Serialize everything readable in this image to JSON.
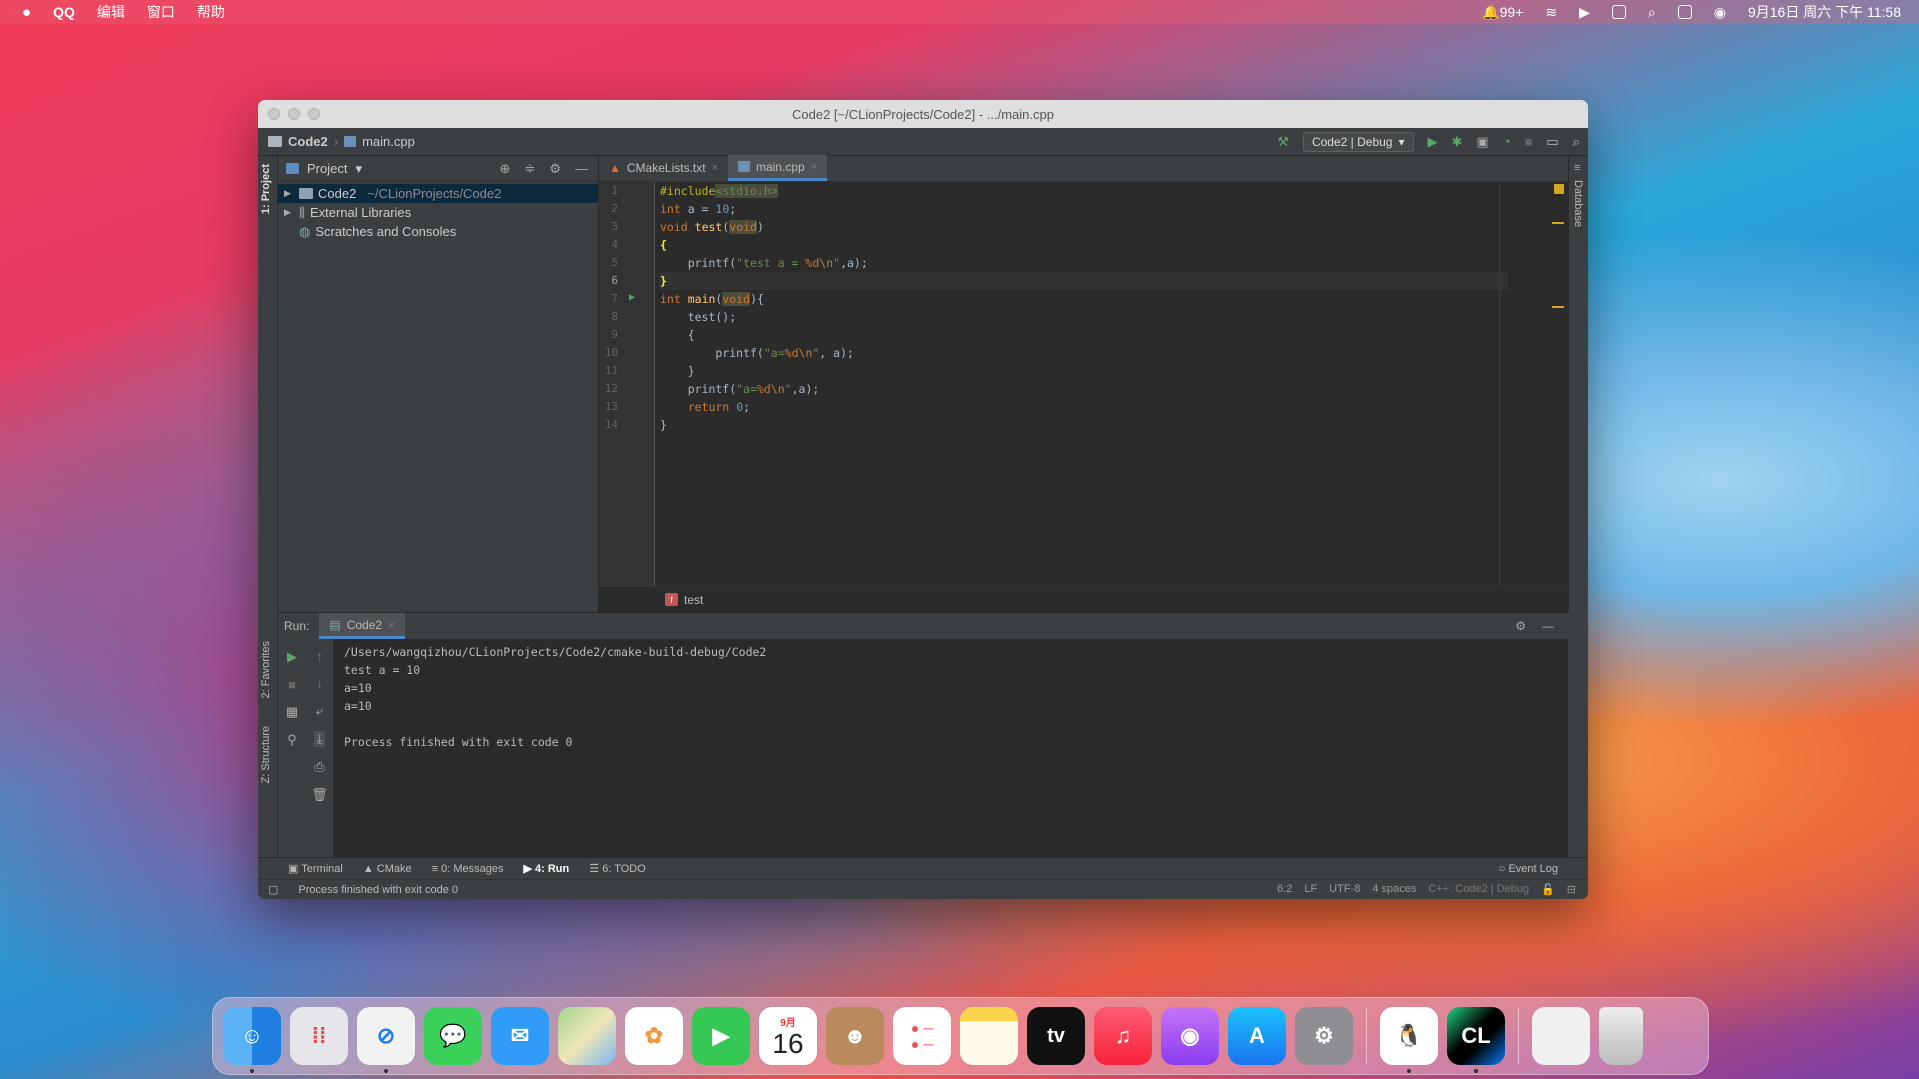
{
  "menubar": {
    "app": "QQ",
    "menus": [
      "编辑",
      "窗口",
      "帮助"
    ],
    "notifications": "99+",
    "datetime": "9月16日 周六 下午 11:58"
  },
  "window": {
    "title": "Code2 [~/CLionProjects/Code2] - .../main.cpp",
    "breadcrumb": {
      "project": "Code2",
      "file": "main.cpp"
    },
    "run_config": "Code2 | Debug"
  },
  "side_tabs": {
    "project": "1: Project",
    "favorites": "2: Favorites",
    "structure": "Z: Structure",
    "database": "Database"
  },
  "project_panel": {
    "title": "Project",
    "nodes": [
      {
        "label": "Code2",
        "path": "~/CLionProjects/Code2"
      },
      {
        "label": "External Libraries",
        "path": ""
      },
      {
        "label": "Scratches and Consoles",
        "path": ""
      }
    ]
  },
  "editor": {
    "tabs": [
      {
        "label": "CMakeLists.txt"
      },
      {
        "label": "main.cpp"
      }
    ],
    "line_numbers": [
      "1",
      "2",
      "3",
      "4",
      "5",
      "6",
      "7",
      "8",
      "9",
      "10",
      "11",
      "12",
      "13",
      "14"
    ],
    "breadcrumb_fn": "test"
  },
  "run_panel": {
    "label": "Run:",
    "tab": "Code2",
    "output": [
      "/Users/wangqizhou/CLionProjects/Code2/cmake-build-debug/Code2",
      "test a = 10",
      "a=10",
      "a=10",
      "",
      "Process finished with exit code 0"
    ]
  },
  "bottom_tools": {
    "terminal": "Terminal",
    "cmake": "CMake",
    "messages": "0: Messages",
    "run": "4: Run",
    "todo": "6: TODO",
    "event_log": "Event Log"
  },
  "status": {
    "message": "Process finished with exit code 0",
    "position": "6:2",
    "line_sep": "LF",
    "encoding": "UTF-8",
    "indent": "4 spaces",
    "context": "C++: Code2 | Debug"
  },
  "dock": {
    "calendar_month": "9月",
    "calendar_day": "16",
    "tv_label": "tv",
    "clion_label": "CL",
    "apps": [
      "finder-icon",
      "launchpad-icon",
      "safari-icon",
      "messages-icon",
      "mail-icon",
      "maps-icon",
      "photos-icon",
      "facetime-icon",
      "calendar-icon",
      "contacts-icon",
      "reminders-icon",
      "notes-icon",
      "appletv-icon",
      "music-icon",
      "podcasts-icon",
      "appstore-icon",
      "settings-icon",
      "qq-icon",
      "clion-icon",
      "preview-icon",
      "trash-icon"
    ]
  }
}
